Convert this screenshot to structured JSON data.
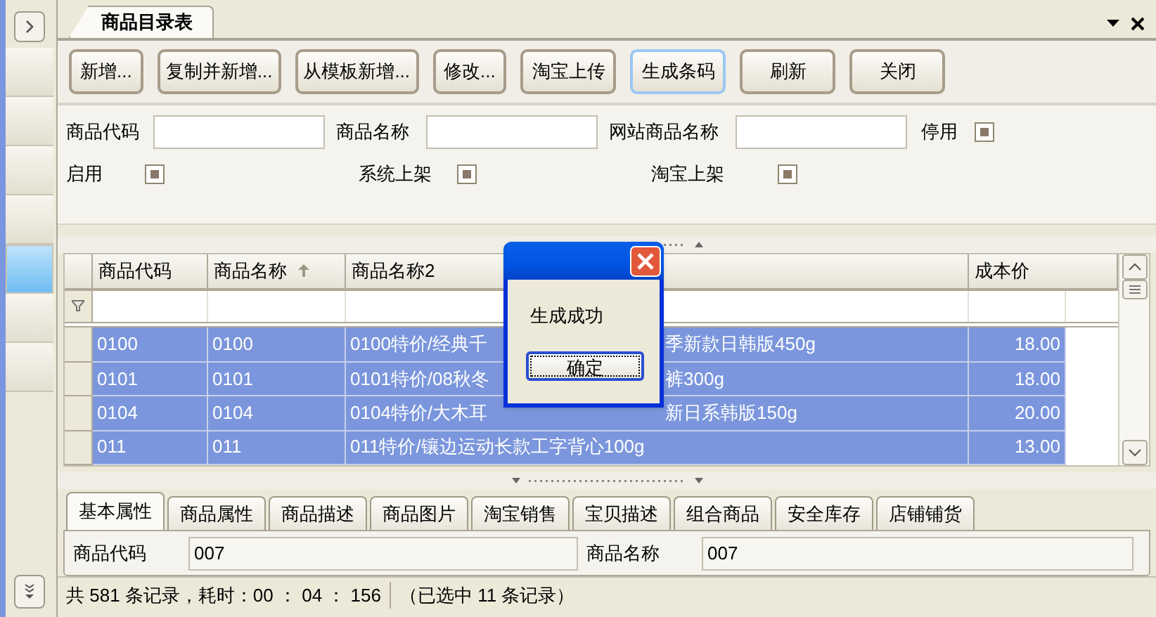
{
  "sidebar": {
    "items": [
      {
        "selected": false
      },
      {
        "selected": false
      },
      {
        "selected": false
      },
      {
        "selected": false
      },
      {
        "selected": true
      },
      {
        "selected": false
      },
      {
        "selected": false
      }
    ]
  },
  "document_tab": {
    "title": "商品目录表",
    "selected": true
  },
  "toolbar": [
    {
      "label": "新增...",
      "focused": false
    },
    {
      "label": "复制并新增...",
      "focused": false
    },
    {
      "label": "从模板新增...",
      "focused": false
    },
    {
      "label": "修改...",
      "focused": false
    },
    {
      "label": "淘宝上传",
      "focused": false
    },
    {
      "label": "生成条码",
      "focused": true
    },
    {
      "label": "刷新",
      "focused": false
    },
    {
      "label": "关闭",
      "focused": false
    }
  ],
  "filters": {
    "fields": [
      {
        "label": "商品代码"
      },
      {
        "label": "商品名称"
      },
      {
        "label": "网站商品名称"
      }
    ],
    "checkboxes": [
      {
        "label": "停用",
        "checked": true
      },
      {
        "label": "启用",
        "checked": true
      },
      {
        "label": "系统上架",
        "checked": true
      },
      {
        "label": "淘宝上架",
        "checked": true
      }
    ]
  },
  "table": {
    "columns": [
      {
        "label": "商品代码",
        "sorted": false
      },
      {
        "label": "商品名称",
        "sorted": true
      },
      {
        "label": "商品名称2",
        "sorted": false
      },
      {
        "label": "成本价",
        "sorted": false
      }
    ],
    "rows": [
      {
        "selected": true,
        "code": "0100",
        "name": "0100",
        "name2": [
          "0100特价/经典千",
          "季新款日韩版450g"
        ],
        "cost": "18.00"
      },
      {
        "selected": true,
        "code": "0101",
        "name": "0101",
        "name2": [
          "0101特价/08秋冬",
          "裤300g"
        ],
        "cost": "18.00"
      },
      {
        "selected": true,
        "code": "0104",
        "name": "0104",
        "name2": [
          "0104特价/大木耳",
          "新日系韩版150g"
        ],
        "cost": "20.00"
      },
      {
        "selected": true,
        "code": "011",
        "name": "011",
        "name2": [
          "011特价/镶边运动长款工字背心100g"
        ],
        "cost": "13.00"
      }
    ]
  },
  "dialog": {
    "message": "生成成功",
    "button": "确定"
  },
  "detail_tabs": [
    {
      "label": "基本属性",
      "selected": true
    },
    {
      "label": "商品属性",
      "selected": false
    },
    {
      "label": "商品描述",
      "selected": false
    },
    {
      "label": "商品图片",
      "selected": false
    },
    {
      "label": "淘宝销售",
      "selected": false
    },
    {
      "label": "宝贝描述",
      "selected": false
    },
    {
      "label": "组合商品",
      "selected": false
    },
    {
      "label": "安全库存",
      "selected": false
    },
    {
      "label": "店铺铺货",
      "selected": false
    }
  ],
  "detail_fields": [
    {
      "label": "商品代码",
      "value": "007"
    },
    {
      "label": "商品名称",
      "value": "007"
    }
  ],
  "status_bar": [
    "共 581 条记录，耗时：00 ： 04 ： 156",
    "（已选中 11 条记录）"
  ]
}
